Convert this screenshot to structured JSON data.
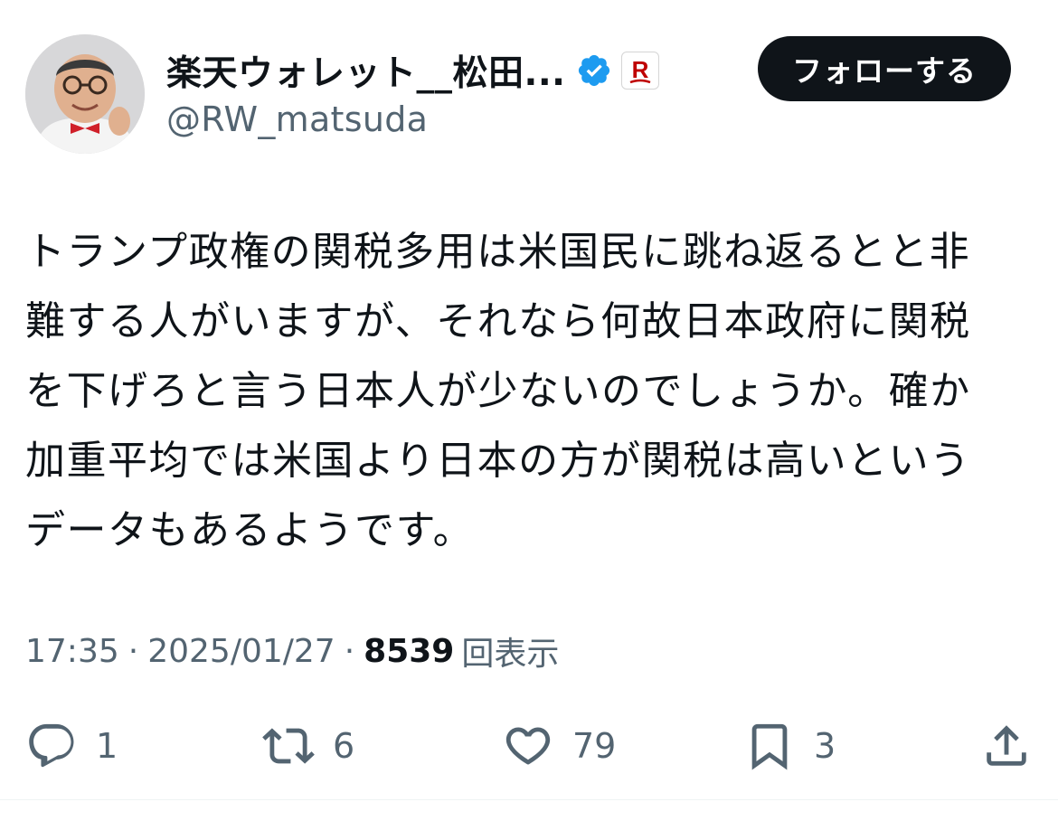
{
  "author": {
    "display_name": "楽天ウォレット__松田...",
    "handle": "@RW_matsuda",
    "avatar_icon": "profile-photo",
    "verified_icon": "verified-badge-icon",
    "brand_badge_letter": "R",
    "brand_color": "#bf0000"
  },
  "follow_label": "フォローする",
  "tweet": {
    "text": "トランプ政権の関税多用は米国民に跳ね返るとと非\n難する人がいますが、それなら何故日本政府に関税\nを下げろと言う日本人が少ないのでしょうか。確か\n加重平均では米国より日本の方が関税は高いという\nデータもあるようです。"
  },
  "meta": {
    "time": "17:35",
    "separator": "·",
    "date": "2025/01/27",
    "views_count": "8539",
    "views_label": "回表示"
  },
  "actions": {
    "reply_count": "1",
    "retweet_count": "6",
    "like_count": "79",
    "bookmark_count": "3"
  },
  "colors": {
    "text": "#0f1419",
    "secondary": "#536471",
    "verified": "#1d9bf0",
    "button_bg": "#0f1419"
  }
}
